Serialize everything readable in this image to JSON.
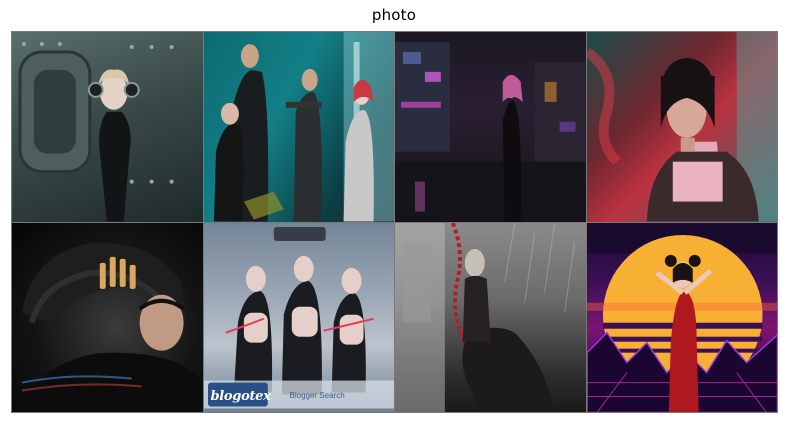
{
  "figure": {
    "title": "photo"
  },
  "tiles": [
    {
      "id": 1,
      "overlay_text": ""
    },
    {
      "id": 2,
      "overlay_text": ""
    },
    {
      "id": 3,
      "overlay_text": ""
    },
    {
      "id": 4,
      "overlay_text": ""
    },
    {
      "id": 5,
      "overlay_text": ""
    },
    {
      "id": 6,
      "overlay_text": "blogotex",
      "overlay_subtext": "Blogger Search"
    },
    {
      "id": 7,
      "overlay_text": ""
    },
    {
      "id": 8,
      "overlay_text": ""
    }
  ],
  "colors": {
    "grid_border": "#7a7a7a",
    "background": "#ffffff"
  }
}
